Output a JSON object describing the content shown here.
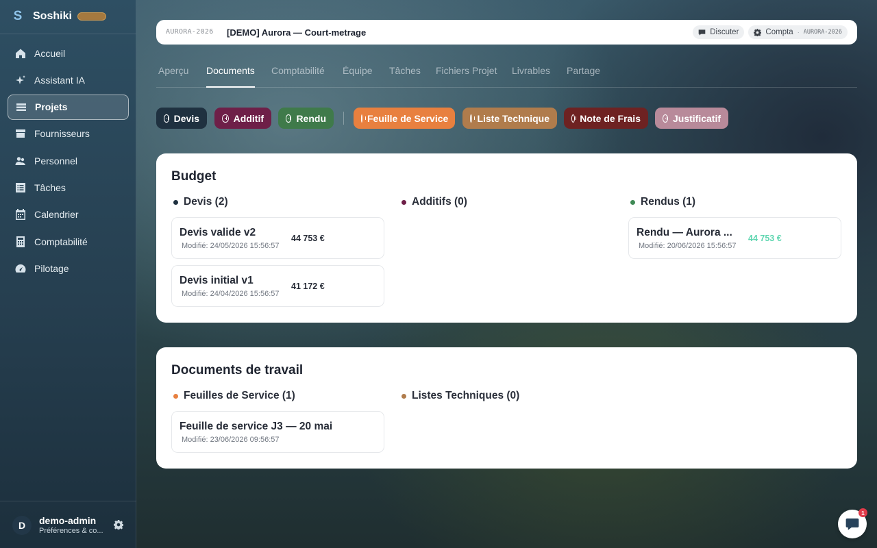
{
  "app": {
    "name": "Soshiki",
    "logo_letter": "S"
  },
  "sidebar": {
    "items": [
      {
        "label": "Accueil",
        "icon": "home-icon"
      },
      {
        "label": "Assistant IA",
        "icon": "sparkle-icon"
      },
      {
        "label": "Projets",
        "icon": "projects-icon",
        "active": true
      },
      {
        "label": "Fournisseurs",
        "icon": "store-icon"
      },
      {
        "label": "Personnel",
        "icon": "people-icon"
      },
      {
        "label": "Tâches",
        "icon": "tasks-icon"
      },
      {
        "label": "Calendrier",
        "icon": "calendar-icon"
      },
      {
        "label": "Comptabilité",
        "icon": "calculator-icon"
      },
      {
        "label": "Pilotage",
        "icon": "gauge-icon"
      }
    ],
    "user": {
      "initial": "D",
      "name": "demo-admin",
      "subtitle": "Préférences & co..."
    }
  },
  "topbar": {
    "project_code": "AURORA-2026",
    "project_title": "[DEMO] Aurora — Court-metrage",
    "discuss_label": "Discuter",
    "compta_label": "Compta",
    "compta_code": "AURORA-2026"
  },
  "tabs": [
    {
      "label": "Aperçu"
    },
    {
      "label": "Documents",
      "active": true
    },
    {
      "label": "Comptabilité"
    },
    {
      "label": "Équipe"
    },
    {
      "label": "Tâches"
    },
    {
      "label": "Fichiers Projet"
    },
    {
      "label": "Livrables"
    },
    {
      "label": "Partage"
    }
  ],
  "doc_buttons": [
    {
      "label": "Devis",
      "color": "#1f3140"
    },
    {
      "label": "Additif",
      "color": "#6e1f48"
    },
    {
      "label": "Rendu",
      "color": "#3f7a4a"
    },
    {
      "label": "Feuille de Service",
      "color": "#e8803f"
    },
    {
      "label": "Liste Technique",
      "color": "#b07c4c"
    },
    {
      "label": "Note de Frais",
      "color": "#6e2222"
    },
    {
      "label": "Justificatif",
      "color": "#b88a9a"
    }
  ],
  "budget": {
    "title": "Budget",
    "devis": {
      "heading": "Devis (2)",
      "bullet_color": "#1f3140",
      "items": [
        {
          "name": "Devis valide v2",
          "modified": "Modifié: 24/05/2026 15:56:57",
          "amount": "44 753 €"
        },
        {
          "name": "Devis initial v1",
          "modified": "Modifié: 24/04/2026 15:56:57",
          "amount": "41 172 €"
        }
      ]
    },
    "additifs": {
      "heading": "Additifs (0)",
      "bullet_color": "#6e1f48"
    },
    "rendus": {
      "heading": "Rendus (1)",
      "bullet_color": "#3f8a55",
      "items": [
        {
          "name": "Rendu — Aurora ...",
          "modified": "Modifié: 20/06/2026 15:56:57",
          "amount": "44 753 €",
          "amount_color": "#5fd6b0"
        }
      ]
    }
  },
  "work_docs": {
    "title": "Documents de travail",
    "feuilles": {
      "heading": "Feuilles de Service (1)",
      "bullet_color": "#e8803f",
      "items": [
        {
          "name": "Feuille de service J3 — 20 mai",
          "modified": "Modifié: 23/06/2026 09:56:57"
        }
      ]
    },
    "listes": {
      "heading": "Listes Techniques (0)",
      "bullet_color": "#b07c4c"
    }
  },
  "chat": {
    "badge": "1"
  }
}
